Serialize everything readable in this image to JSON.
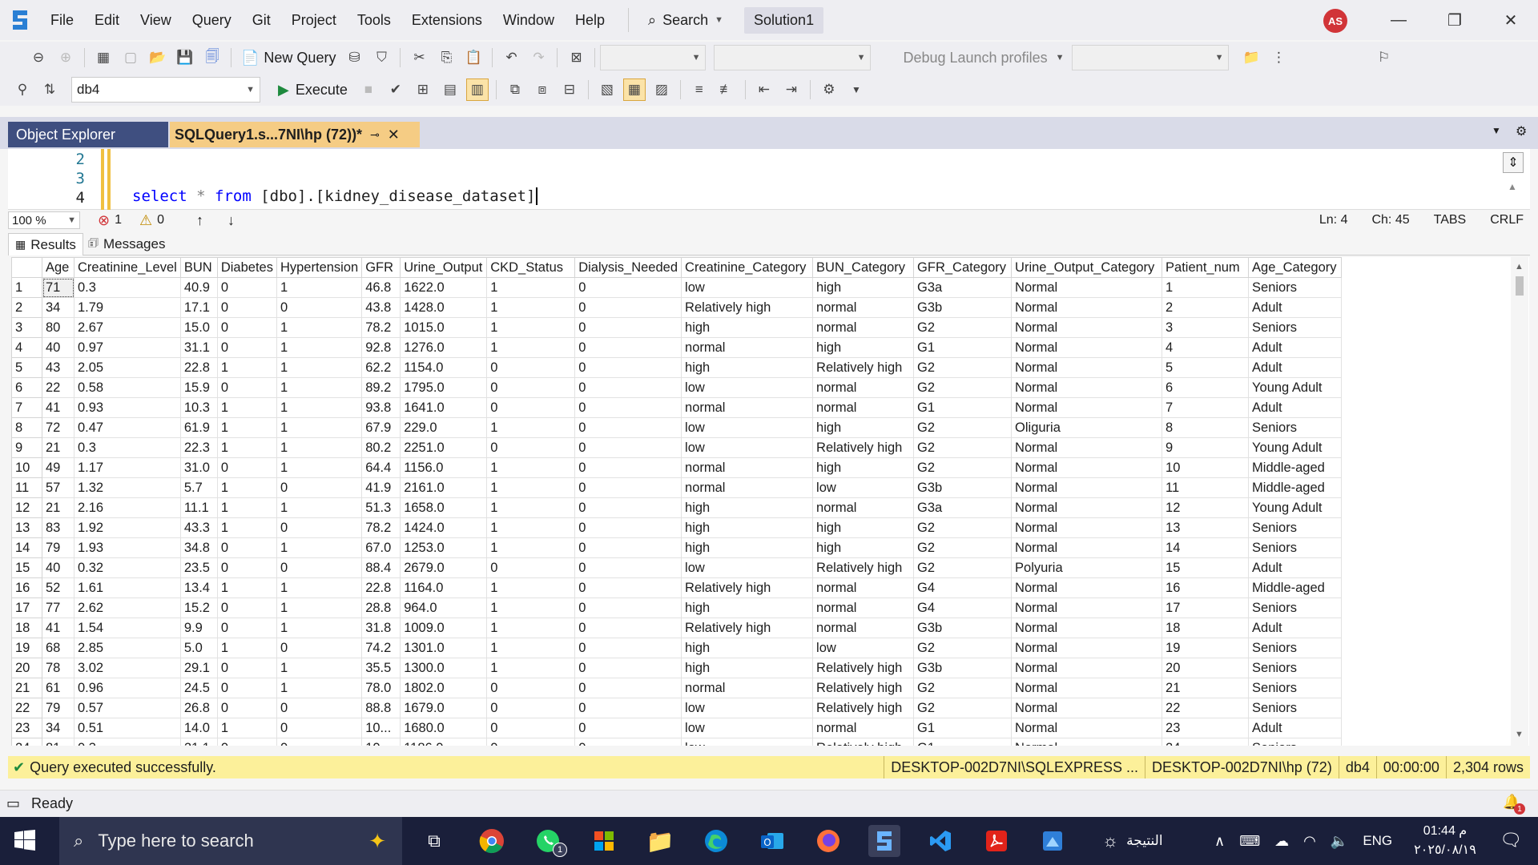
{
  "menu": [
    "File",
    "Edit",
    "View",
    "Query",
    "Git",
    "Project",
    "Tools",
    "Extensions",
    "Window",
    "Help"
  ],
  "search_label": "Search",
  "solution_name": "Solution1",
  "user_initials": "AS",
  "toolbar": {
    "new_query": "New Query",
    "debug_profiles": "Debug Launch profiles",
    "execute": "Execute",
    "database": "db4"
  },
  "tabs": {
    "object_explorer": "Object Explorer",
    "query_tab": "SQLQuery1.s...7NI\\hp (72))*"
  },
  "editor": {
    "line_numbers": [
      "2",
      "3",
      "4"
    ],
    "code": {
      "select": "select",
      "star": "*",
      "from": "from",
      "rest": "[dbo].[kidney_disease_dataset]"
    }
  },
  "editor_status": {
    "zoom": "100 %",
    "errors": "1",
    "warnings": "0",
    "ln": "Ln: 4",
    "ch": "Ch: 45",
    "tabs": "TABS",
    "eol": "CRLF"
  },
  "results_tabs": {
    "results": "Results",
    "messages": "Messages"
  },
  "grid": {
    "columns": [
      "Age",
      "Creatinine_Level",
      "BUN",
      "Diabetes",
      "Hypertension",
      "GFR",
      "Urine_Output",
      "CKD_Status",
      "Dialysis_Needed",
      "Creatinine_Category",
      "BUN_Category",
      "GFR_Category",
      "Urine_Output_Category",
      "Patient_num",
      "Age_Category"
    ],
    "rows": [
      [
        "1",
        "71",
        "0.3",
        "40.9",
        "0",
        "1",
        "46.8",
        "1622.0",
        "1",
        "0",
        "low",
        "high",
        "G3a",
        "Normal",
        "1",
        "Seniors"
      ],
      [
        "2",
        "34",
        "1.79",
        "17.1",
        "0",
        "0",
        "43.8",
        "1428.0",
        "1",
        "0",
        "Relatively high",
        "normal",
        "G3b",
        "Normal",
        "2",
        "Adult"
      ],
      [
        "3",
        "80",
        "2.67",
        "15.0",
        "0",
        "1",
        "78.2",
        "1015.0",
        "1",
        "0",
        "high",
        "normal",
        "G2",
        "Normal",
        "3",
        "Seniors"
      ],
      [
        "4",
        "40",
        "0.97",
        "31.1",
        "0",
        "1",
        "92.8",
        "1276.0",
        "1",
        "0",
        "normal",
        "high",
        "G1",
        "Normal",
        "4",
        "Adult"
      ],
      [
        "5",
        "43",
        "2.05",
        "22.8",
        "1",
        "1",
        "62.2",
        "1154.0",
        "0",
        "0",
        "high",
        "Relatively high",
        "G2",
        "Normal",
        "5",
        "Adult"
      ],
      [
        "6",
        "22",
        "0.58",
        "15.9",
        "0",
        "1",
        "89.2",
        "1795.0",
        "0",
        "0",
        "low",
        "normal",
        "G2",
        "Normal",
        "6",
        "Young Adult"
      ],
      [
        "7",
        "41",
        "0.93",
        "10.3",
        "1",
        "1",
        "93.8",
        "1641.0",
        "0",
        "0",
        "normal",
        "normal",
        "G1",
        "Normal",
        "7",
        "Adult"
      ],
      [
        "8",
        "72",
        "0.47",
        "61.9",
        "1",
        "1",
        "67.9",
        "229.0",
        "1",
        "0",
        "low",
        "high",
        "G2",
        "Oliguria",
        "8",
        "Seniors"
      ],
      [
        "9",
        "21",
        "0.3",
        "22.3",
        "1",
        "1",
        "80.2",
        "2251.0",
        "0",
        "0",
        "low",
        "Relatively high",
        "G2",
        "Normal",
        "9",
        "Young Adult"
      ],
      [
        "10",
        "49",
        "1.17",
        "31.0",
        "0",
        "1",
        "64.4",
        "1156.0",
        "1",
        "0",
        "normal",
        "high",
        "G2",
        "Normal",
        "10",
        "Middle-aged"
      ],
      [
        "11",
        "57",
        "1.32",
        "5.7",
        "1",
        "0",
        "41.9",
        "2161.0",
        "1",
        "0",
        "normal",
        "low",
        "G3b",
        "Normal",
        "11",
        "Middle-aged"
      ],
      [
        "12",
        "21",
        "2.16",
        "11.1",
        "1",
        "1",
        "51.3",
        "1658.0",
        "1",
        "0",
        "high",
        "normal",
        "G3a",
        "Normal",
        "12",
        "Young Adult"
      ],
      [
        "13",
        "83",
        "1.92",
        "43.3",
        "1",
        "0",
        "78.2",
        "1424.0",
        "1",
        "0",
        "high",
        "high",
        "G2",
        "Normal",
        "13",
        "Seniors"
      ],
      [
        "14",
        "79",
        "1.93",
        "34.8",
        "0",
        "1",
        "67.0",
        "1253.0",
        "1",
        "0",
        "high",
        "high",
        "G2",
        "Normal",
        "14",
        "Seniors"
      ],
      [
        "15",
        "40",
        "0.32",
        "23.5",
        "0",
        "0",
        "88.4",
        "2679.0",
        "0",
        "0",
        "low",
        "Relatively high",
        "G2",
        "Polyuria",
        "15",
        "Adult"
      ],
      [
        "16",
        "52",
        "1.61",
        "13.4",
        "1",
        "1",
        "22.8",
        "1164.0",
        "1",
        "0",
        "Relatively high",
        "normal",
        "G4",
        "Normal",
        "16",
        "Middle-aged"
      ],
      [
        "17",
        "77",
        "2.62",
        "15.2",
        "0",
        "1",
        "28.8",
        "964.0",
        "1",
        "0",
        "high",
        "normal",
        "G4",
        "Normal",
        "17",
        "Seniors"
      ],
      [
        "18",
        "41",
        "1.54",
        "9.9",
        "0",
        "1",
        "31.8",
        "1009.0",
        "1",
        "0",
        "Relatively high",
        "normal",
        "G3b",
        "Normal",
        "18",
        "Adult"
      ],
      [
        "19",
        "68",
        "2.85",
        "5.0",
        "1",
        "0",
        "74.2",
        "1301.0",
        "1",
        "0",
        "high",
        "low",
        "G2",
        "Normal",
        "19",
        "Seniors"
      ],
      [
        "20",
        "78",
        "3.02",
        "29.1",
        "0",
        "1",
        "35.5",
        "1300.0",
        "1",
        "0",
        "high",
        "Relatively high",
        "G3b",
        "Normal",
        "20",
        "Seniors"
      ],
      [
        "21",
        "61",
        "0.96",
        "24.5",
        "0",
        "1",
        "78.0",
        "1802.0",
        "0",
        "0",
        "normal",
        "Relatively high",
        "G2",
        "Normal",
        "21",
        "Seniors"
      ],
      [
        "22",
        "79",
        "0.57",
        "26.8",
        "0",
        "0",
        "88.8",
        "1679.0",
        "0",
        "0",
        "low",
        "Relatively high",
        "G2",
        "Normal",
        "22",
        "Seniors"
      ],
      [
        "23",
        "34",
        "0.51",
        "14.0",
        "1",
        "0",
        "10...",
        "1680.0",
        "0",
        "0",
        "low",
        "normal",
        "G1",
        "Normal",
        "23",
        "Adult"
      ],
      [
        "24",
        "81",
        "0.3",
        "21.1",
        "0",
        "0",
        "10...",
        "1186.0",
        "0",
        "0",
        "low",
        "Relatively high",
        "G1",
        "Normal",
        "24",
        "Seniors"
      ]
    ]
  },
  "query_status": {
    "message": "Query executed successfully.",
    "server": "DESKTOP-002D7NI\\SQLEXPRESS ...",
    "login": "DESKTOP-002D7NI\\hp (72)",
    "db": "db4",
    "time": "00:00:00",
    "rows": "2,304 rows"
  },
  "status_bar": {
    "ready": "Ready",
    "notifications": "1"
  },
  "taskbar": {
    "search_placeholder": "Type here to search",
    "weather": "النتيجة",
    "lang": "ENG",
    "time": "01:44 م",
    "date": "٢٠٢٥/٠٨/١٩",
    "whatsapp_badge": "1"
  },
  "colors": {
    "accent_tab": "#3f4f80",
    "active_query_tab": "#f5cc84",
    "status_yellow": "#fcf09a",
    "taskbar_bg": "#1a1f3a"
  }
}
